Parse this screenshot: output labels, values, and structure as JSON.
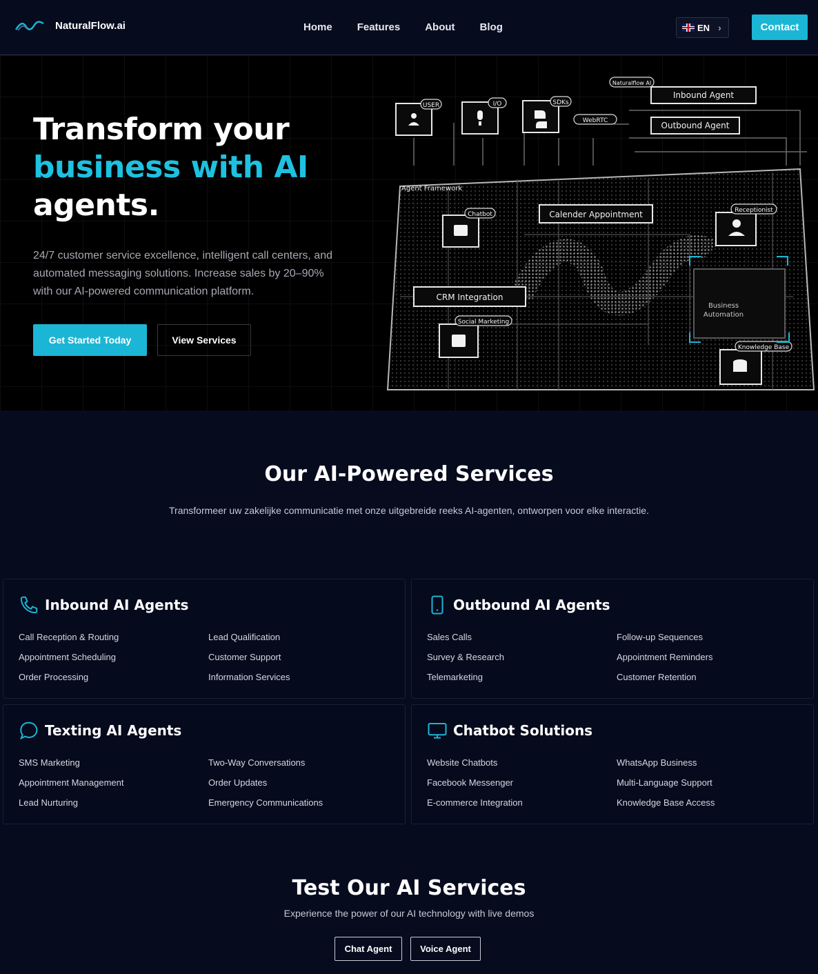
{
  "brand": {
    "name": "NaturalFlow.ai"
  },
  "nav": {
    "links": [
      "Home",
      "Features",
      "About",
      "Blog"
    ],
    "language": "EN",
    "contact": "Contact"
  },
  "hero": {
    "title_line1": "Transform your",
    "title_accent": "business with AI",
    "title_line3": "agents.",
    "description": "24/7 customer service excellence, intelligent call centers, and automated messaging solutions. Increase sales by 20–90% with our AI-powered communication platform.",
    "primary_cta": "Get Started Today",
    "secondary_cta": "View Services",
    "diagram": {
      "tags": {
        "user": "USER",
        "io": "I/O",
        "sdks": "SDKs",
        "webrtc": "WebRTC",
        "naturalflow": "Naturalflow AI",
        "inbound": "Inbound Agent",
        "outbound": "Outbound Agent",
        "framework": "Agent Framework",
        "chatbot": "Chatbot",
        "calendar": "Calender Appointment",
        "receptionist": "Receptionist",
        "crm": "CRM Integration",
        "business1": "Business",
        "business2": "Automation",
        "social": "Social Marketing",
        "knowledge": "Knowledge Base"
      }
    }
  },
  "services": {
    "title": "Our AI-Powered Services",
    "subtitle": "Transformeer uw zakelijke communicatie met onze uitgebreide reeks AI-agenten, ontworpen voor elke interactie.",
    "cards": [
      {
        "title": "Inbound AI Agents",
        "icon": "phone-icon",
        "items": [
          "Call Reception & Routing",
          "Lead Qualification",
          "Appointment Scheduling",
          "Customer Support",
          "Order Processing",
          "Information Services"
        ]
      },
      {
        "title": "Outbound AI Agents",
        "icon": "mobile-icon",
        "items": [
          "Sales Calls",
          "Follow-up Sequences",
          "Survey & Research",
          "Appointment Reminders",
          "Telemarketing",
          "Customer Retention"
        ]
      },
      {
        "title": "Texting AI Agents",
        "icon": "chat-bubble-icon",
        "items": [
          "SMS Marketing",
          "Two-Way Conversations",
          "Appointment Management",
          "Order Updates",
          "Lead Nurturing",
          "Emergency Communications"
        ]
      },
      {
        "title": "Chatbot Solutions",
        "icon": "monitor-icon",
        "items": [
          "Website Chatbots",
          "WhatsApp Business",
          "Facebook Messenger",
          "Multi-Language Support",
          "E-commerce Integration",
          "Knowledge Base Access"
        ]
      }
    ]
  },
  "test": {
    "title": "Test Our AI Services",
    "subtitle": "Experience the power of our AI technology with live demos",
    "chat_button": "Chat Agent",
    "voice_button": "Voice Agent"
  },
  "colors": {
    "accent": "#1bb6d5",
    "background": "#060b1e",
    "hero_background": "#000000"
  }
}
